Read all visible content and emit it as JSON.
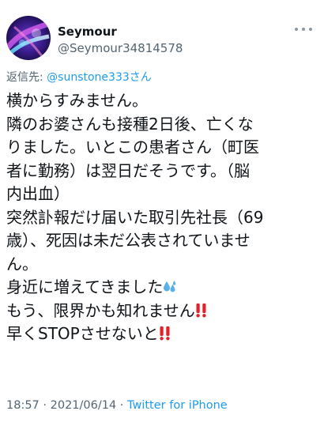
{
  "tweet": {
    "display_name": "Seymour",
    "handle": "@Seymour34814578",
    "reply_prefix": "返信先: ",
    "reply_to": "@sunstone333さん",
    "lines": [
      "横からすみません。",
      "隣のお婆さんも接種2日後、亡くな",
      "りました。いとこの患者さん（町医",
      "者に勤務）は翌日だそうです。（脳",
      "内出血）",
      "突然訃報だけ届いた取引先社長（69",
      "歳）、死因は未だ公表されていませ",
      "ん。",
      "身近に増えてきました",
      "もう、限界かも知れません",
      "早くSTOPさせないと"
    ],
    "emoji": {
      "line9": "sweat-droplets-icon",
      "line10": "double-exclamation-icon",
      "line11": "double-exclamation-icon"
    },
    "time": "18:57",
    "separator": " · ",
    "date": "2021/06/14",
    "source": "Twitter for iPhone"
  },
  "colors": {
    "text": "#0f1419",
    "secondary": "#536471",
    "link": "#1d9bf0",
    "emoji_red": "#e0202b",
    "emoji_blue": "#5ab0e8"
  }
}
